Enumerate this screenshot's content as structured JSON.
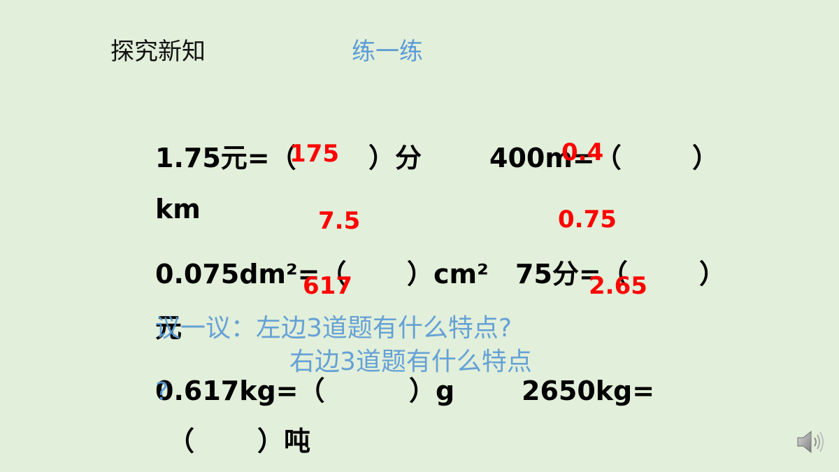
{
  "slide": {
    "section_title": "探究新知",
    "subtitle": "练一练"
  },
  "questions": {
    "q1_left": "1.75元=（",
    "q1_mid": "）分",
    "q1_right": "400m=（",
    "q1_close": "）",
    "q1_unit": "km",
    "q2_left": "0.075dm²=（",
    "q2_mid": "）cm²",
    "q2_right": "75分=（",
    "q2_close": "）",
    "q2_unit": "元",
    "q3_left": "0.617kg=（",
    "q3_mid": "）g",
    "q3_right": "2650kg=",
    "q3_paren": "（",
    "q3_close": "）吨"
  },
  "answers": {
    "a1": "175",
    "a2": "0.4",
    "a3": "7.5",
    "a4": "0.75",
    "a5": "617",
    "a6": "2.65"
  },
  "discussion": {
    "line1": "议一议：左边3道题有什么特点?",
    "line2": "右边3道题有什么特点",
    "line3": "?"
  },
  "icons": {
    "speaker": "speaker-icon"
  },
  "colors": {
    "background": "#e2efda",
    "answer": "#ff0000",
    "accent": "#5b9bd5"
  }
}
